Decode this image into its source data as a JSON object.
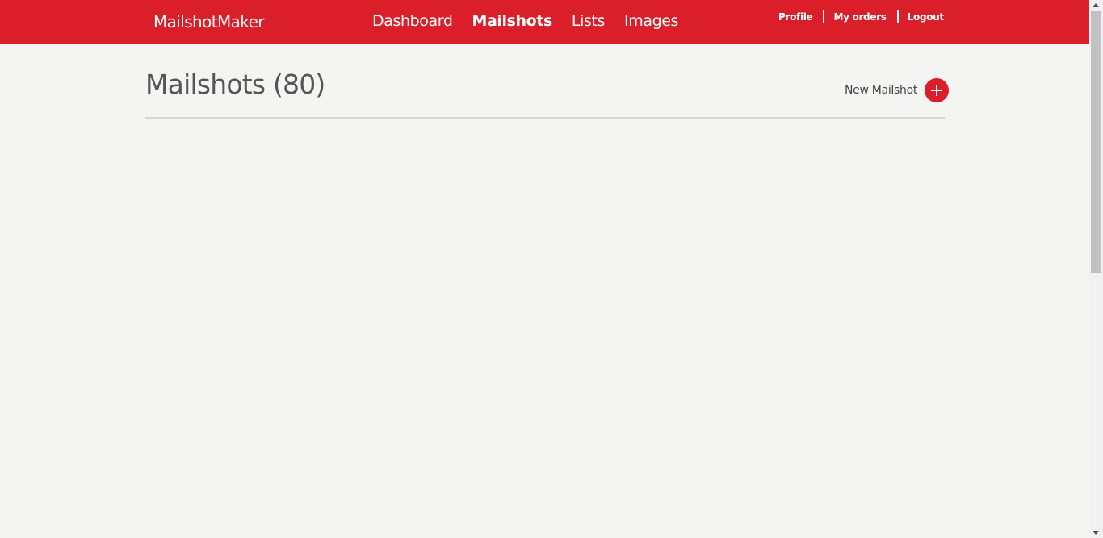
{
  "brand": {
    "part1": "Mailshot",
    "part2": "Maker"
  },
  "main_nav": [
    {
      "label": "Dashboard",
      "active": false
    },
    {
      "label": "Mailshots",
      "active": true
    },
    {
      "label": "Lists",
      "active": false
    },
    {
      "label": "Images",
      "active": false
    }
  ],
  "user_nav": [
    {
      "label": "Profile"
    },
    {
      "label": "My orders"
    },
    {
      "label": "Logout"
    }
  ],
  "page": {
    "title": "Mailshots (80)",
    "new_button_label": "New Mailshot",
    "new_button_icon": "plus-circle-icon"
  },
  "colors": {
    "brand_red": "#da1f2a",
    "background": "#f4f4f2"
  }
}
